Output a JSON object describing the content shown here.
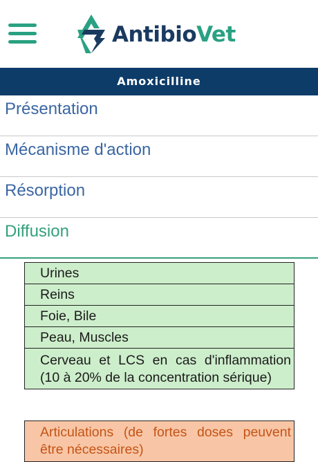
{
  "app": {
    "logo_text_part1": "Antibio",
    "logo_text_part2": "Vet",
    "menu_icon": "hamburger-icon",
    "logo_icon": "star-of-life-icon"
  },
  "drug": {
    "name": "Amoxicilline"
  },
  "sections": [
    {
      "label": "Présentation"
    },
    {
      "label": "Mécanisme d'action"
    },
    {
      "label": "Résorption"
    },
    {
      "label": "Diffusion"
    }
  ],
  "diffusion": {
    "good": [
      "Urines",
      "Reins",
      "Foie, Bile",
      "Peau, Muscles",
      "Cerveau et LCS en cas d'inflammation (10 à 20% de la concentration sérique)"
    ],
    "partial": [
      "Articulations (de fortes doses peuvent être nécessaires)"
    ]
  },
  "colors": {
    "brand_green": "#2aa183",
    "brand_navy": "#0e3c69",
    "section_blue": "#3b66a2",
    "good_bg": "#cdeecb",
    "partial_bg": "#f8c6a6",
    "partial_text": "#c45417"
  }
}
